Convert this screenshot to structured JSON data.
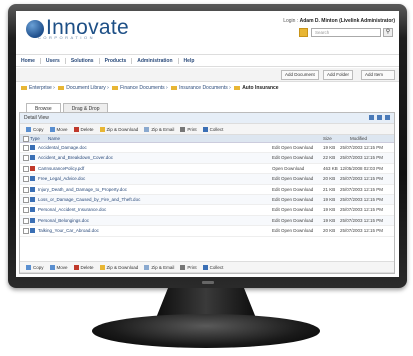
{
  "header": {
    "logo_text": "Innovate",
    "logo_sub": "CORPORATION",
    "login_prefix": "Login :",
    "login_user": "Adam D. Minton (Livelink Administrator)",
    "search_placeholder": "Search"
  },
  "nav": [
    "Home",
    "Users",
    "Solutions",
    "Products",
    "Administration",
    "Help"
  ],
  "toolbar": {
    "add_document": "Add Document",
    "add_folder": "Add Folder",
    "add_item": "Add Item"
  },
  "breadcrumb": [
    "Enterprise",
    "Document Library",
    "Finance Documents",
    "Insurance Documents"
  ],
  "breadcrumb_current": "Auto Insurance",
  "tabs": [
    "Browse",
    "Drag & Drop"
  ],
  "panel_title": "Detail View",
  "actions": [
    "Copy",
    "Move",
    "Delete",
    "Zip & Download",
    "Zip & Email",
    "Print",
    "Collect"
  ],
  "columns": {
    "type": "Type",
    "name": "Name",
    "size": "Size",
    "modified": "Modified"
  },
  "rows": [
    {
      "name": "Accidental_Damage.doc",
      "actions": "Edit  Open  Download",
      "size": "19 KB",
      "modified": "25/07/2003 12:15 PM",
      "type": "doc"
    },
    {
      "name": "Accident_and_Breakdown_Cover.doc",
      "actions": "Edit  Open  Download",
      "size": "22 KB",
      "modified": "25/07/2003 12:15 PM",
      "type": "doc"
    },
    {
      "name": "CarInsurancePolicy.pdf",
      "actions": "Open  Download",
      "size": "463 KB",
      "modified": "12/05/2008 02:03 PM",
      "type": "pdf"
    },
    {
      "name": "Free_Legal_Advice.doc",
      "actions": "Edit  Open  Download",
      "size": "20 KB",
      "modified": "25/07/2003 12:15 PM",
      "type": "doc"
    },
    {
      "name": "Injury_Death_and_Damage_to_Property.doc",
      "actions": "Edit  Open  Download",
      "size": "21 KB",
      "modified": "25/07/2003 12:15 PM",
      "type": "doc"
    },
    {
      "name": "Loss_or_Damage_Caused_by_Fire_and_Theft.doc",
      "actions": "Edit  Open  Download",
      "size": "19 KB",
      "modified": "25/07/2003 12:15 PM",
      "type": "doc"
    },
    {
      "name": "Personal_Accident_Insurance.doc",
      "actions": "Edit  Open  Download",
      "size": "19 KB",
      "modified": "25/07/2003 12:15 PM",
      "type": "doc"
    },
    {
      "name": "Personal_Belongings.doc",
      "actions": "Edit  Open  Download",
      "size": "19 KB",
      "modified": "25/07/2003 12:15 PM",
      "type": "doc"
    },
    {
      "name": "Talking_Your_Car_Abroad.doc",
      "actions": "Edit  Open  Download",
      "size": "20 KB",
      "modified": "25/07/2003 12:15 PM",
      "type": "doc"
    }
  ],
  "colors": {
    "brand": "#1d4f86",
    "accent": "#e8b634",
    "link": "#2a4a7a"
  }
}
